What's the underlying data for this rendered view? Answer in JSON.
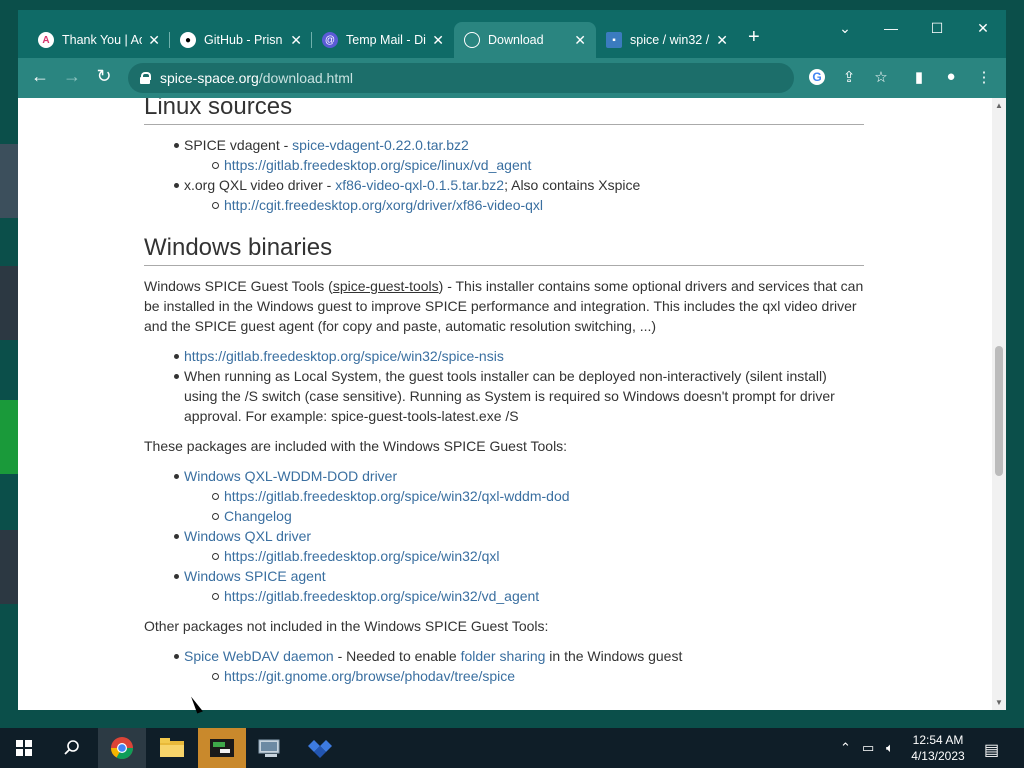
{
  "tabs": [
    {
      "title": "Thank You | Ac",
      "icon": "arc-logo-icon"
    },
    {
      "title": "GitHub - Prisn",
      "icon": "github-icon"
    },
    {
      "title": "Temp Mail - Di",
      "icon": "temp-mail-icon"
    },
    {
      "title": "Download",
      "icon": "globe-icon",
      "active": true
    },
    {
      "title": "spice / win32 /",
      "icon": "gitlab-icon"
    }
  ],
  "url": {
    "domain": "spice-space.org",
    "path": "/download.html"
  },
  "page": {
    "linux_heading": "Linux sources",
    "vdagent_label": "SPICE vdagent - ",
    "vdagent_link": "spice-vdagent-0.22.0.tar.bz2",
    "vdagent_repo": "https://gitlab.freedesktop.org/spice/linux/vd_agent",
    "qxl_label": "x.org QXL video driver - ",
    "qxl_link": "xf86-video-qxl-0.1.5.tar.bz2",
    "qxl_suffix": "; Also contains Xspice",
    "qxl_repo": "http://cgit.freedesktop.org/xorg/driver/xf86-video-qxl",
    "windows_heading": "Windows binaries",
    "guest_tools_prefix": "Windows SPICE Guest Tools (",
    "guest_tools_link": "spice-guest-tools",
    "guest_tools_desc": ") - This installer contains some optional drivers and services that can be installed in the Windows guest to improve SPICE performance and integration. This includes the qxl video driver and the SPICE guest agent (for copy and paste, automatic resolution switching, ...)",
    "nsis_repo": "https://gitlab.freedesktop.org/spice/win32/spice-nsis",
    "local_system_note": "When running as Local System, the guest tools installer can be deployed non-interactively (silent install) using the /S switch (case sensitive). Running as System is required so Windows doesn't prompt for driver approval. For example: spice-guest-tools-latest.exe /S",
    "included_intro": "These packages are included with the Windows SPICE Guest Tools:",
    "wddm_link": "Windows QXL-WDDM-DOD driver",
    "wddm_repo": "https://gitlab.freedesktop.org/spice/win32/qxl-wddm-dod",
    "changelog_link": "Changelog",
    "qxl_win_link": "Windows QXL driver",
    "qxl_win_repo": "https://gitlab.freedesktop.org/spice/win32/qxl",
    "agent_link": "Windows SPICE agent",
    "agent_repo": "https://gitlab.freedesktop.org/spice/win32/vd_agent",
    "other_intro": "Other packages not included in the Windows SPICE Guest Tools:",
    "webdav_link": "Spice WebDAV daemon",
    "webdav_mid": " - Needed to enable ",
    "folder_sharing_link": "folder sharing",
    "webdav_suffix": " in the Windows guest",
    "phodav_repo": "https://git.gnome.org/browse/phodav/tree/spice"
  },
  "clock": {
    "time": "12:54 AM",
    "date": "4/13/2023"
  },
  "colors": {
    "tabbar": "#0f6b67",
    "toolbar": "#2a8580",
    "link": "#3a6fa0",
    "taskbar": "#0f1e28"
  }
}
